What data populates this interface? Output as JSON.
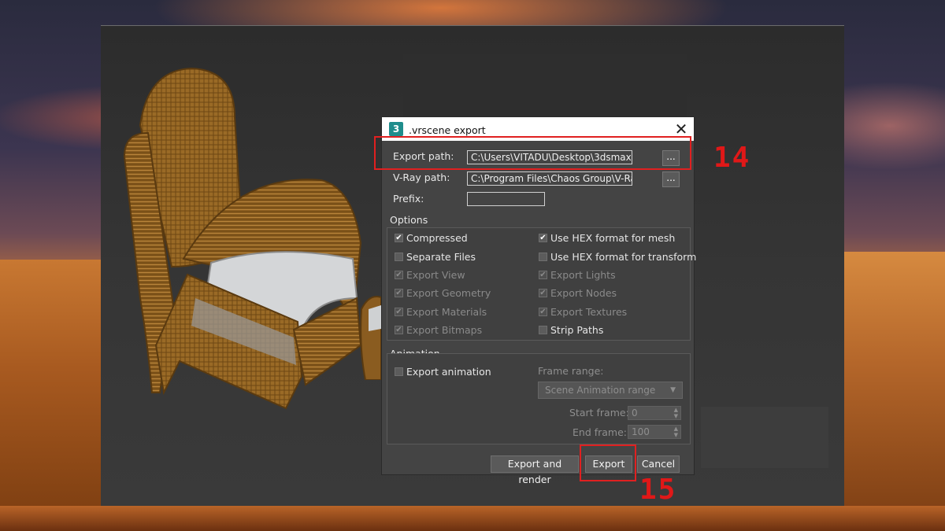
{
  "dialog": {
    "title": ".vrscene export",
    "app_icon": "3",
    "close_icon": "close-icon",
    "export_path_label": "Export path:",
    "export_path_value": "C:\\Users\\VITADU\\Desktop\\3dsmax",
    "vray_path_label": "V-Ray path:",
    "vray_path_value": "C:\\Program Files\\Chaos Group\\V-Ra",
    "prefix_label": "Prefix:",
    "prefix_value": "",
    "browse_label": "...",
    "options": {
      "title": "Options",
      "left": [
        {
          "label": "Compressed",
          "checked": true,
          "enabled": true
        },
        {
          "label": "Separate Files",
          "checked": false,
          "enabled": true
        },
        {
          "label": "Export View",
          "checked": true,
          "enabled": false
        },
        {
          "label": "Export Geometry",
          "checked": true,
          "enabled": false
        },
        {
          "label": "Export Materials",
          "checked": true,
          "enabled": false
        },
        {
          "label": "Export Bitmaps",
          "checked": true,
          "enabled": false
        }
      ],
      "right": [
        {
          "label": "Use HEX format for mesh",
          "checked": true,
          "enabled": true
        },
        {
          "label": "Use HEX format for transform",
          "checked": false,
          "enabled": true
        },
        {
          "label": "Export Lights",
          "checked": true,
          "enabled": false
        },
        {
          "label": "Export Nodes",
          "checked": true,
          "enabled": false
        },
        {
          "label": "Export Textures",
          "checked": true,
          "enabled": false
        },
        {
          "label": "Strip Paths",
          "checked": false,
          "enabled": true
        }
      ]
    },
    "animation": {
      "title": "Animation",
      "export_animation": "Export animation",
      "frame_range_label": "Frame range:",
      "frame_range_value": "Scene Animation range",
      "start_frame_label": "Start frame:",
      "start_frame_value": "0",
      "end_frame_label": "End frame:",
      "end_frame_value": "100"
    },
    "buttons": {
      "export_and_render": "Export and render",
      "export": "Export",
      "cancel": "Cancel"
    }
  },
  "annotations": {
    "step_export_path": "14",
    "step_export_button": "15",
    "color": "#e02020"
  }
}
